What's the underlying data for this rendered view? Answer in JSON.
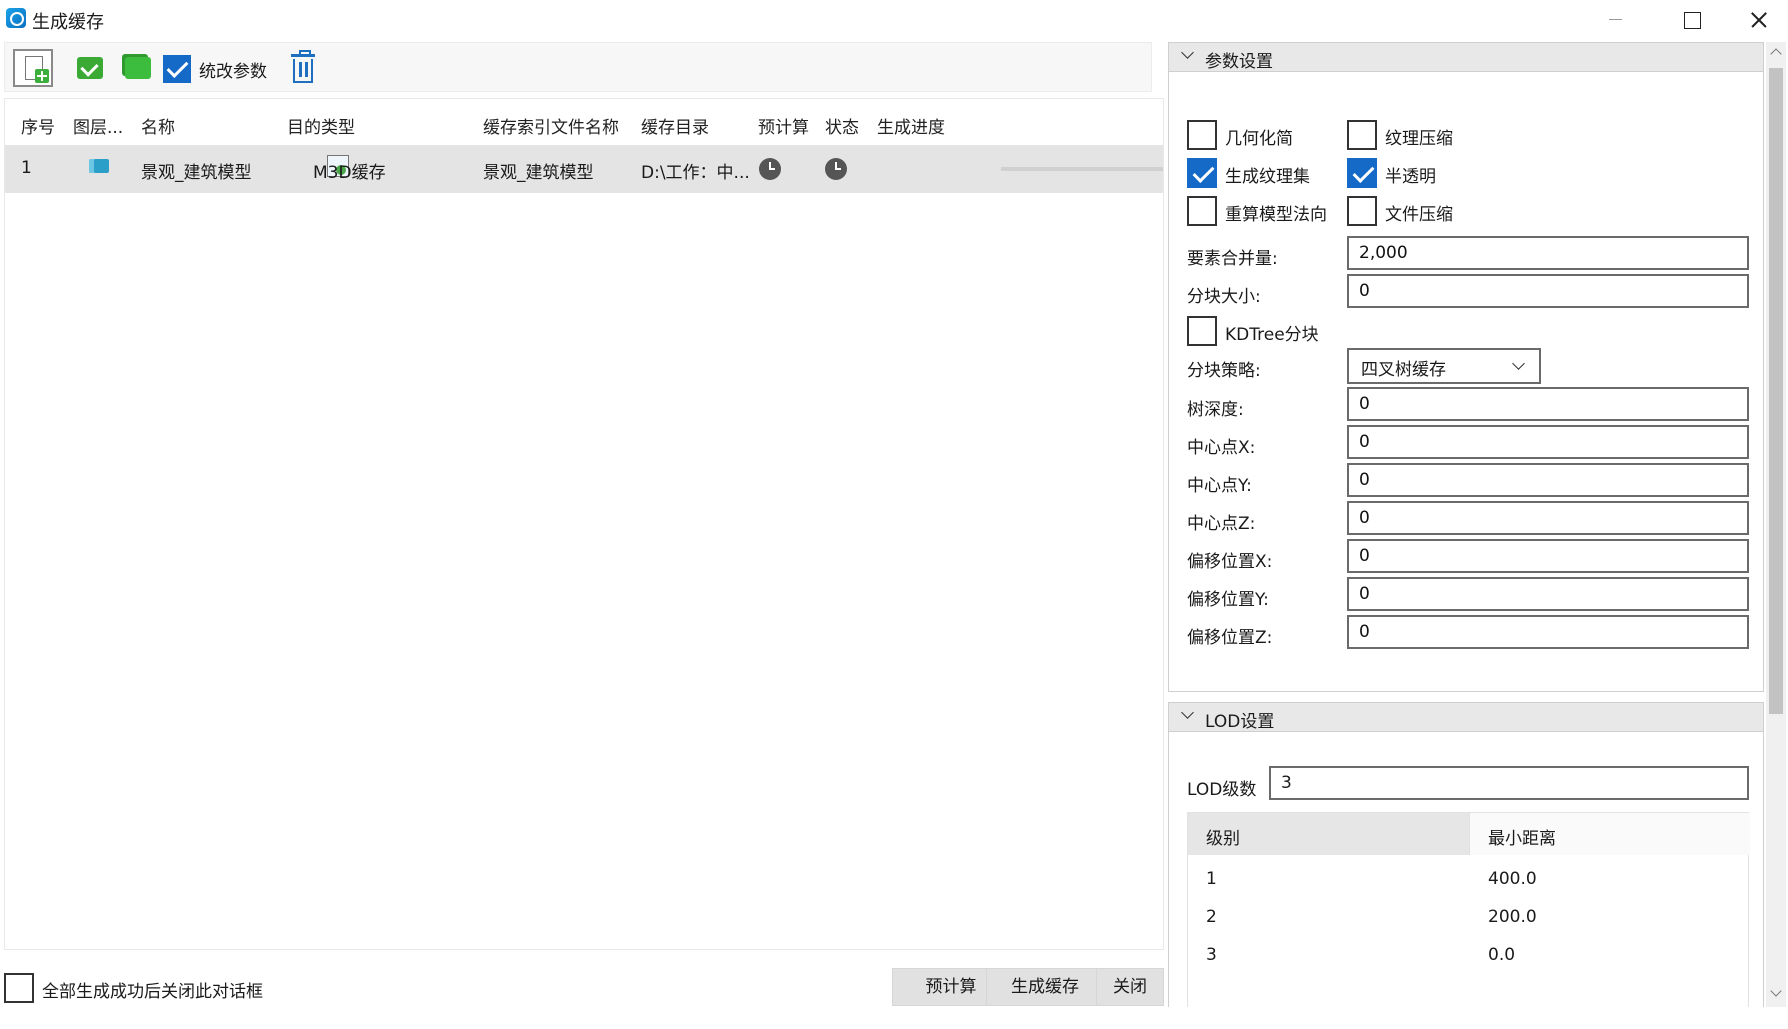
{
  "window": {
    "title": "生成缓存"
  },
  "toolbar": {
    "new_task_icon": "new-document-icon",
    "select_all_icon": "check-all-icon",
    "invert_select_icon": "invert-select-icon",
    "unify_params_label": "统改参数",
    "unify_params_checked": true,
    "delete_icon": "trash-icon"
  },
  "table": {
    "columns": [
      "序号",
      "图层...",
      "名称",
      "目的类型",
      "缓存索引文件名称",
      "缓存目录",
      "预计算",
      "状态",
      "生成进度"
    ],
    "rows": [
      {
        "index": "1",
        "layer_icon": "layer-icon",
        "name": "景观_建筑模型",
        "target_type": "M3D缓存",
        "index_file": "景观_建筑模型",
        "cache_dir": "D:\\工作：中...",
        "precalc_icon": "clock-icon",
        "status_icon": "clock-icon",
        "progress": 0
      }
    ]
  },
  "footer": {
    "close_after_label": "全部生成成功后关闭此对话框",
    "close_after_checked": false,
    "precalc_button": "预计算",
    "generate_button": "生成缓存",
    "close_button": "关闭"
  },
  "params": {
    "header": "参数设置",
    "geometry_simplify": {
      "label": "几何化简",
      "checked": false
    },
    "texture_compress": {
      "label": "纹理压缩",
      "checked": false
    },
    "gen_texture_set": {
      "label": "生成纹理集",
      "checked": true
    },
    "semi_transparent": {
      "label": "半透明",
      "checked": true
    },
    "recompute_normals": {
      "label": "重算模型法向",
      "checked": false
    },
    "file_compress": {
      "label": "文件压缩",
      "checked": false
    },
    "merge_count_label": "要素合并量:",
    "merge_count": "2,000",
    "block_size_label": "分块大小:",
    "block_size": "0",
    "kdtree": {
      "label": "KDTree分块",
      "checked": false
    },
    "split_strategy_label": "分块策略:",
    "split_strategy": "四叉树缓存",
    "tree_depth_label": "树深度:",
    "tree_depth": "0",
    "center_x_label": "中心点X:",
    "center_x": "0",
    "center_y_label": "中心点Y:",
    "center_y": "0",
    "center_z_label": "中心点Z:",
    "center_z": "0",
    "offset_x_label": "偏移位置X:",
    "offset_x": "0",
    "offset_y_label": "偏移位置Y:",
    "offset_y": "0",
    "offset_z_label": "偏移位置Z:",
    "offset_z": "0"
  },
  "lod": {
    "header": "LOD设置",
    "count_label": "LOD级数",
    "count": "3",
    "columns": [
      "级别",
      "最小距离"
    ],
    "rows": [
      {
        "level": "1",
        "min_distance": "400.0"
      },
      {
        "level": "2",
        "min_distance": "200.0"
      },
      {
        "level": "3",
        "min_distance": "0.0"
      }
    ]
  }
}
